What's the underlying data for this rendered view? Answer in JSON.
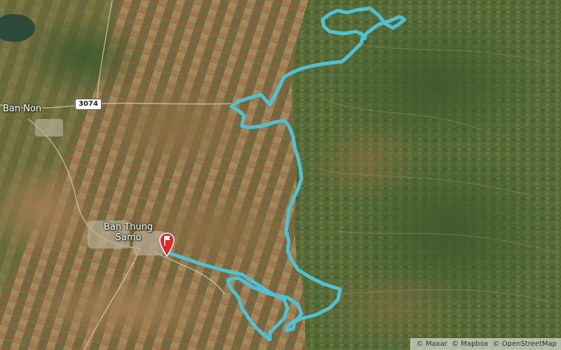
{
  "map": {
    "places": [
      {
        "id": "ban-non",
        "label": "Ban Non"
      },
      {
        "id": "ban-thung-samo",
        "label": "Ban Thung\nSamo"
      }
    ],
    "road_shield": "3074",
    "attribution": [
      "© Maxar",
      "© Mapbox",
      "© OpenStreetMap"
    ],
    "route_color": "#4fc1d3",
    "marker_color": "#e0262d",
    "icons": {
      "start_marker": "flag-marker-icon"
    }
  }
}
